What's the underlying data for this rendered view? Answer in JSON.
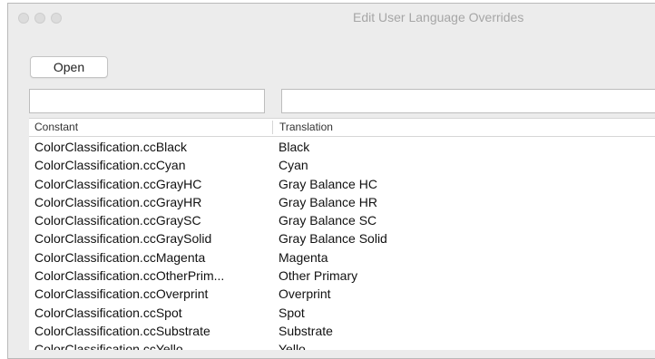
{
  "window": {
    "title": "Edit User Language Overrides"
  },
  "toolbar": {
    "open_label": "Open"
  },
  "filters": {
    "constant_value": "",
    "translation_value": ""
  },
  "table": {
    "columns": [
      "Constant",
      "Translation"
    ],
    "rows": [
      {
        "constant": "ColorClassification.ccBlack",
        "translation": "Black"
      },
      {
        "constant": "ColorClassification.ccCyan",
        "translation": "Cyan"
      },
      {
        "constant": "ColorClassification.ccGrayHC",
        "translation": "Gray Balance HC"
      },
      {
        "constant": "ColorClassification.ccGrayHR",
        "translation": "Gray Balance HR"
      },
      {
        "constant": "ColorClassification.ccGraySC",
        "translation": "Gray Balance SC"
      },
      {
        "constant": "ColorClassification.ccGraySolid",
        "translation": "Gray Balance Solid"
      },
      {
        "constant": "ColorClassification.ccMagenta",
        "translation": "Magenta"
      },
      {
        "constant": "ColorClassification.ccOtherPrim...",
        "translation": "Other Primary"
      },
      {
        "constant": "ColorClassification.ccOverprint",
        "translation": "Overprint"
      },
      {
        "constant": "ColorClassification.ccSpot",
        "translation": "Spot"
      },
      {
        "constant": "ColorClassification.ccSubstrate",
        "translation": "Substrate"
      },
      {
        "constant": "ColorClassification.ccYello...",
        "translation": "Yello..."
      }
    ]
  }
}
